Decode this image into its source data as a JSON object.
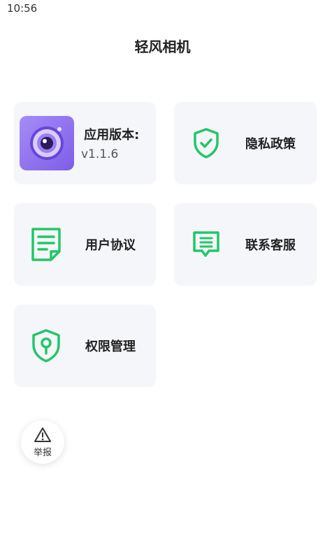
{
  "status_bar": {
    "time": "10:56"
  },
  "header": {
    "title": "轻风相机"
  },
  "cards": {
    "version": {
      "label": "应用版本:",
      "value": "v1.1.6",
      "icon": "camera-app-icon"
    },
    "privacy": {
      "label": "隐私政策",
      "icon": "shield-check-icon"
    },
    "agreement": {
      "label": "用户协议",
      "icon": "document-icon"
    },
    "support": {
      "label": "联系客服",
      "icon": "chat-icon"
    },
    "permissions": {
      "label": "权限管理",
      "icon": "shield-key-icon"
    }
  },
  "report": {
    "label": "举报",
    "icon": "warning-icon"
  },
  "colors": {
    "accent": "#22c768",
    "card_bg": "#f5f6fa",
    "app_icon": "#8b6cf0"
  }
}
